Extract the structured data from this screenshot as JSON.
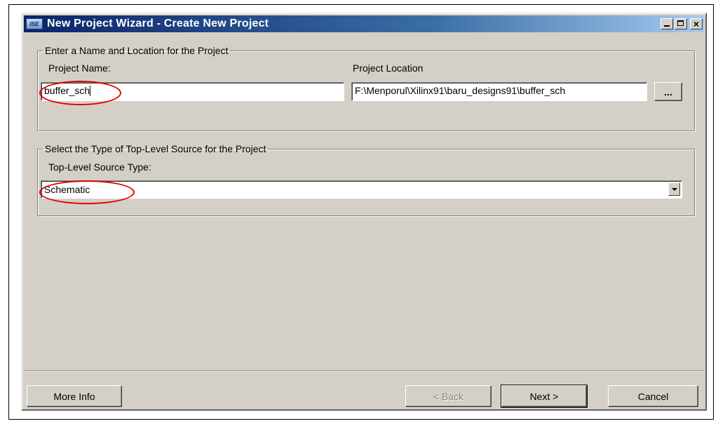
{
  "window": {
    "title": "New Project Wizard - Create New Project",
    "icon_name": "ise-app-icon",
    "icon_text": "ISE",
    "title_buttons": [
      "minimize-icon",
      "maximize-icon",
      "close-icon"
    ],
    "close_glyph": "×"
  },
  "group_name_location": {
    "legend": "Enter a Name and Location for the Project",
    "project_name_label": "Project Name:",
    "project_name_value": "buffer_sch",
    "project_location_label": "Project Location",
    "project_location_value": "F:\\Menporul\\Xilinx91\\baru_designs91\\buffer_sch",
    "browse_label": "..."
  },
  "group_source_type": {
    "legend": "Select the Type of Top-Level Source for the Project",
    "source_type_label": "Top-Level Source Type:",
    "source_type_value": "Schematic"
  },
  "footer": {
    "more_info_label": "More Info",
    "back_label": "< Back",
    "next_label": "Next >",
    "cancel_label": "Cancel"
  },
  "annotations": {
    "highlight_color": "#e00000"
  }
}
